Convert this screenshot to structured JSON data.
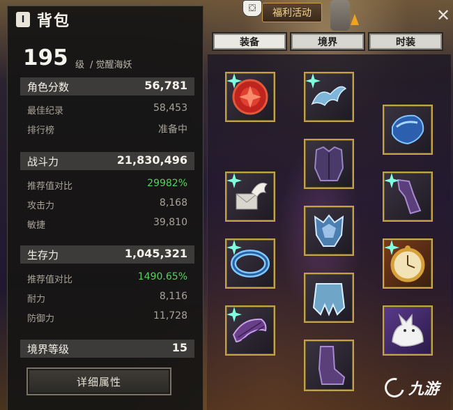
{
  "window": {
    "title": "背包",
    "title_key": "I"
  },
  "character": {
    "level": "195",
    "level_unit": "级",
    "class_title": "/ 觉醒海妖"
  },
  "score": {
    "label": "角色分数",
    "value": "56,781",
    "best_label": "最佳纪录",
    "best_value": "58,453",
    "rank_label": "排行榜",
    "rank_value": "准备中"
  },
  "combat": {
    "label": "战斗力",
    "value": "21,830,496",
    "ratio_label": "推荐值对比",
    "ratio_value": "29982%",
    "attack_label": "攻击力",
    "attack_value": "8,168",
    "agility_label": "敏捷",
    "agility_value": "39,810"
  },
  "survival": {
    "label": "生存力",
    "value": "1,045,321",
    "ratio_label": "推荐值对比",
    "ratio_value": "1490.65%",
    "endurance_label": "耐力",
    "endurance_value": "8,116",
    "defense_label": "防御力",
    "defense_value": "11,728"
  },
  "realm": {
    "label": "境界等级",
    "value": "15"
  },
  "detail_button": "详细属性",
  "event_button": "福利活动",
  "tabs": [
    {
      "label": "装备",
      "active": true
    },
    {
      "label": "境界",
      "active": false
    },
    {
      "label": "时装",
      "active": false
    }
  ],
  "equipment_slots": [
    {
      "name": "red-gem-orb-icon",
      "enhanced": true
    },
    {
      "name": "crystal-horn-helmet-icon",
      "enhanced": true
    },
    {
      "name": "blue-gauntlet-icon",
      "enhanced": false
    },
    {
      "name": "purple-chest-armor-icon",
      "enhanced": false
    },
    {
      "name": "winged-letter-icon",
      "enhanced": true
    },
    {
      "name": "purple-leg-armor-icon",
      "enhanced": true
    },
    {
      "name": "crystal-shoulder-armor-icon",
      "enhanced": false
    },
    {
      "name": "blue-bracelet-icon",
      "enhanced": true
    },
    {
      "name": "golden-pocket-watch-icon",
      "enhanced": true
    },
    {
      "name": "crystal-skirt-armor-icon",
      "enhanced": false
    },
    {
      "name": "purple-belt-icon",
      "enhanced": true
    },
    {
      "name": "white-wolf-pet-icon",
      "enhanced": false
    },
    {
      "name": "purple-boots-icon",
      "enhanced": false
    }
  ],
  "watermark": "九游",
  "colors": {
    "highlight_green": "#58d15a",
    "slot_border": "#c4a24a",
    "event_text": "#f4d58c"
  }
}
